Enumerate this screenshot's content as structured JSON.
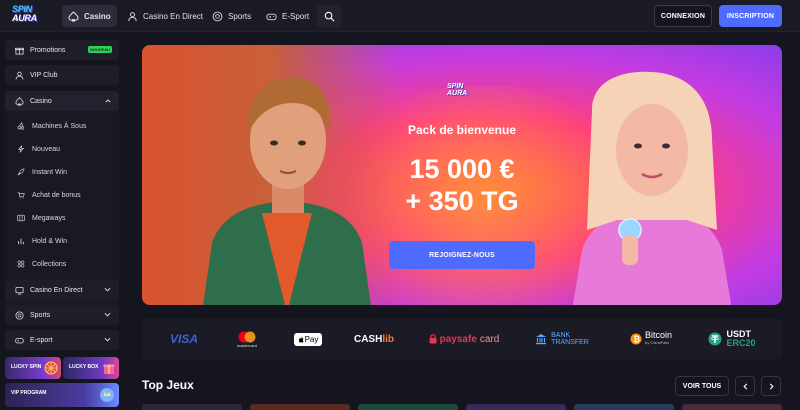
{
  "header": {
    "logo": "SPIN AURA",
    "nav": [
      {
        "label": "Casino",
        "icon": "spade-icon",
        "active": true
      },
      {
        "label": "Casino En Direct",
        "icon": "live-casino-icon",
        "active": false
      },
      {
        "label": "Sports",
        "icon": "soccer-ball-icon",
        "active": false
      },
      {
        "label": "E-Sport",
        "icon": "gamepad-icon",
        "active": false
      }
    ],
    "search_icon": "search-icon",
    "login_label": "CONNEXION",
    "signup_label": "INSCRIPTION"
  },
  "sidebar": {
    "promotions": {
      "label": "Promotions",
      "badge": "NOUVEAU"
    },
    "vip_club": "VIP Club",
    "casino": {
      "label": "Casino",
      "items": [
        "Machines À Sous",
        "Nouveau",
        "Instant Win",
        "Achat de bonus",
        "Megaways",
        "Hold & Win",
        "Collections"
      ]
    },
    "casino_live": "Casino En Direct",
    "sports": "Sports",
    "esport": "E-sport",
    "tiles": [
      "LUCKY SPIN",
      "LUCKY BOX",
      "VIP PROGRAM"
    ]
  },
  "hero": {
    "logo": "SPIN AURA",
    "subtitle": "Pack de bienvenue",
    "amount_line1": "15 000 €",
    "amount_line2": "+ 350 TG",
    "cta": "REJOIGNEZ-NOUS"
  },
  "payments": {
    "visa": "VISA",
    "mastercard": "mastercard",
    "applepay": "Pay",
    "cashlib_a": "CASH",
    "cashlib_b": "lib",
    "paysafe_a": "paysafe",
    "paysafe_b": "card",
    "bank_a": "BANK",
    "bank_b": "TRANSFER",
    "bitcoin": "Bitcoin",
    "bitcoin_sub": "by CoinsPaid",
    "usdt_a": "USDT",
    "usdt_b": "ERC20"
  },
  "top_games": {
    "title": "Top Jeux",
    "see_all": "VOIR TOUS"
  },
  "colors": {
    "accent": "#4f6bff",
    "background": "#15151f",
    "panel": "#1e1e2a",
    "new_badge": "#2fd158"
  }
}
